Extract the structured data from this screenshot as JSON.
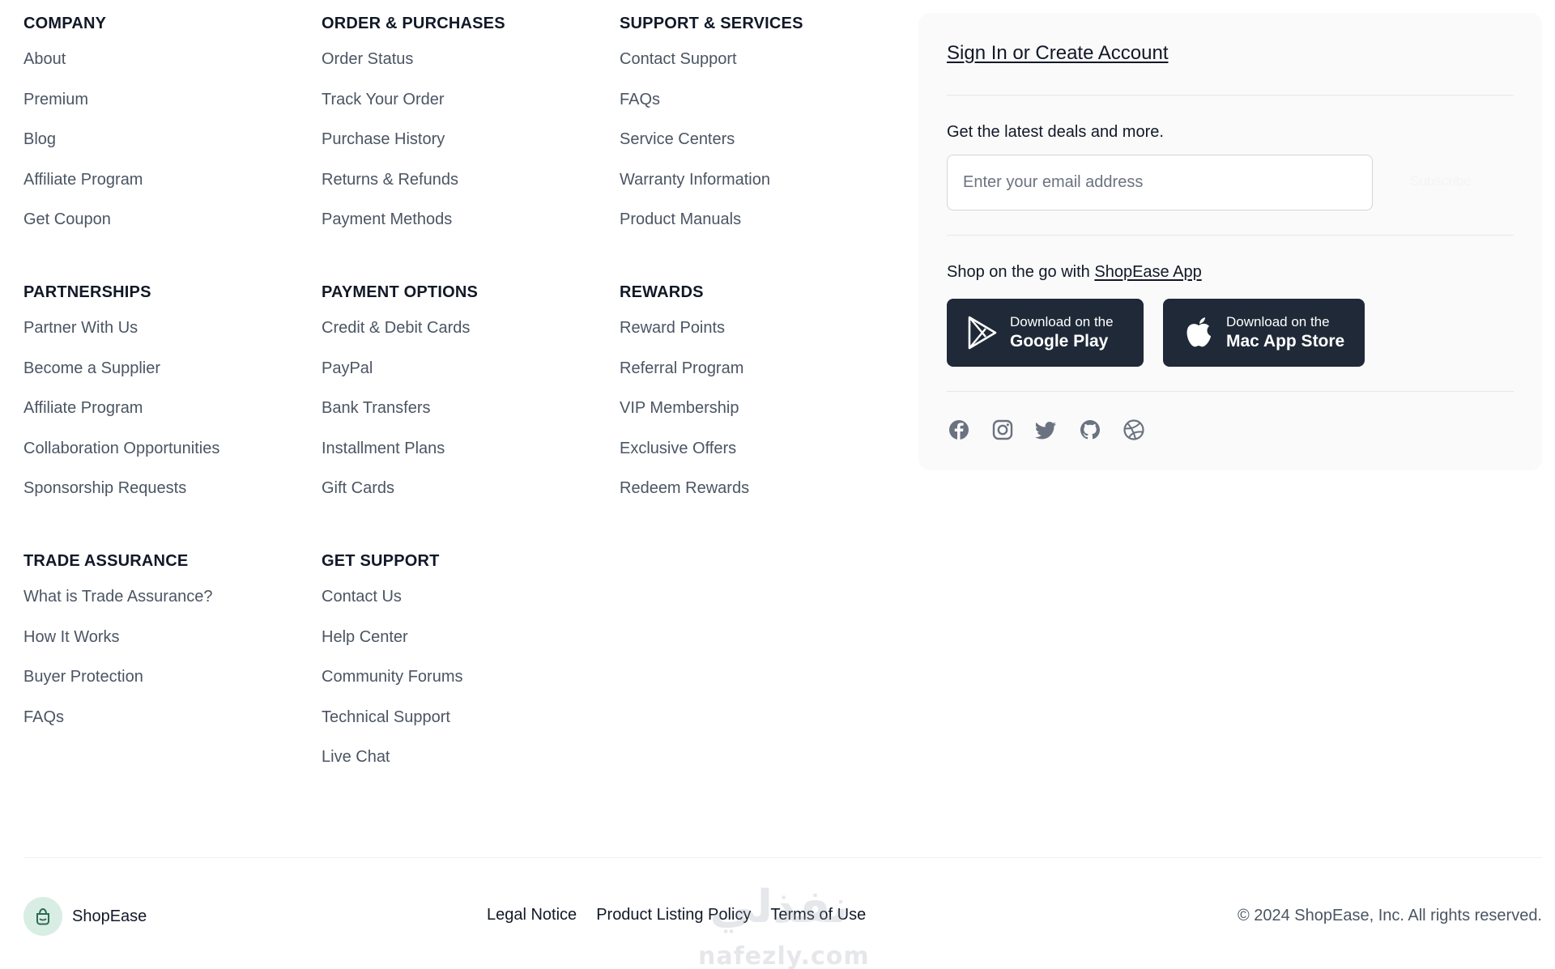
{
  "columns": {
    "company": {
      "title": "COMPANY",
      "links": [
        "About",
        "Premium",
        "Blog",
        "Affiliate Program",
        "Get Coupon"
      ]
    },
    "order_purchases": {
      "title": "ORDER & PURCHASES",
      "links": [
        "Order Status",
        "Track Your Order",
        "Purchase History",
        "Returns & Refunds",
        "Payment Methods"
      ]
    },
    "support_services": {
      "title": "SUPPORT & SERVICES",
      "links": [
        "Contact Support",
        "FAQs",
        "Service Centers",
        "Warranty Information",
        "Product Manuals"
      ]
    },
    "partnerships": {
      "title": "PARTNERSHIPS",
      "links": [
        "Partner With Us",
        "Become a Supplier",
        "Affiliate Program",
        "Collaboration Opportunities",
        "Sponsorship Requests"
      ]
    },
    "payment_options": {
      "title": "PAYMENT OPTIONS",
      "links": [
        "Credit & Debit Cards",
        "PayPal",
        "Bank Transfers",
        "Installment Plans",
        "Gift Cards"
      ]
    },
    "rewards": {
      "title": "REWARDS",
      "links": [
        "Reward Points",
        "Referral Program",
        "VIP Membership",
        "Exclusive Offers",
        "Redeem Rewards"
      ]
    },
    "trade_assurance": {
      "title": "TRADE ASSURANCE",
      "links": [
        "What is Trade Assurance?",
        "How It Works",
        "Buyer Protection",
        "FAQs"
      ]
    },
    "get_support": {
      "title": "GET SUPPORT",
      "links": [
        "Contact Us",
        "Help Center",
        "Community Forums",
        "Technical Support",
        "Live Chat"
      ]
    }
  },
  "panel": {
    "signin_label": "Sign In or Create Account",
    "deals_text": "Get the latest deals and more.",
    "email_placeholder": "Enter your email address",
    "subscribe_label": "Subscribe",
    "app_prefix": "Shop on the go with ",
    "app_link": "ShopEase App",
    "google_play": {
      "line1": "Download on the",
      "line2": "Google Play"
    },
    "app_store": {
      "line1": "Download on the",
      "line2": "Mac App Store"
    },
    "socials": [
      "facebook-icon",
      "instagram-icon",
      "twitter-icon",
      "github-icon",
      "dribbble-icon"
    ]
  },
  "footer": {
    "brand_name": "ShopEase",
    "legal_links": [
      "Legal Notice",
      "Product Listing Policy",
      "Terms of Use"
    ],
    "copyright": "© 2024 ShopEase, Inc. All rights reserved."
  },
  "watermark": {
    "arabic": "نفذلي",
    "latin": "nafezly.com"
  },
  "colors": {
    "heading": "#111827",
    "link": "#4b5563",
    "button_bg": "#1f2937",
    "panel_bg": "#fafafa",
    "brand_logo_bg": "#d8ede3"
  }
}
